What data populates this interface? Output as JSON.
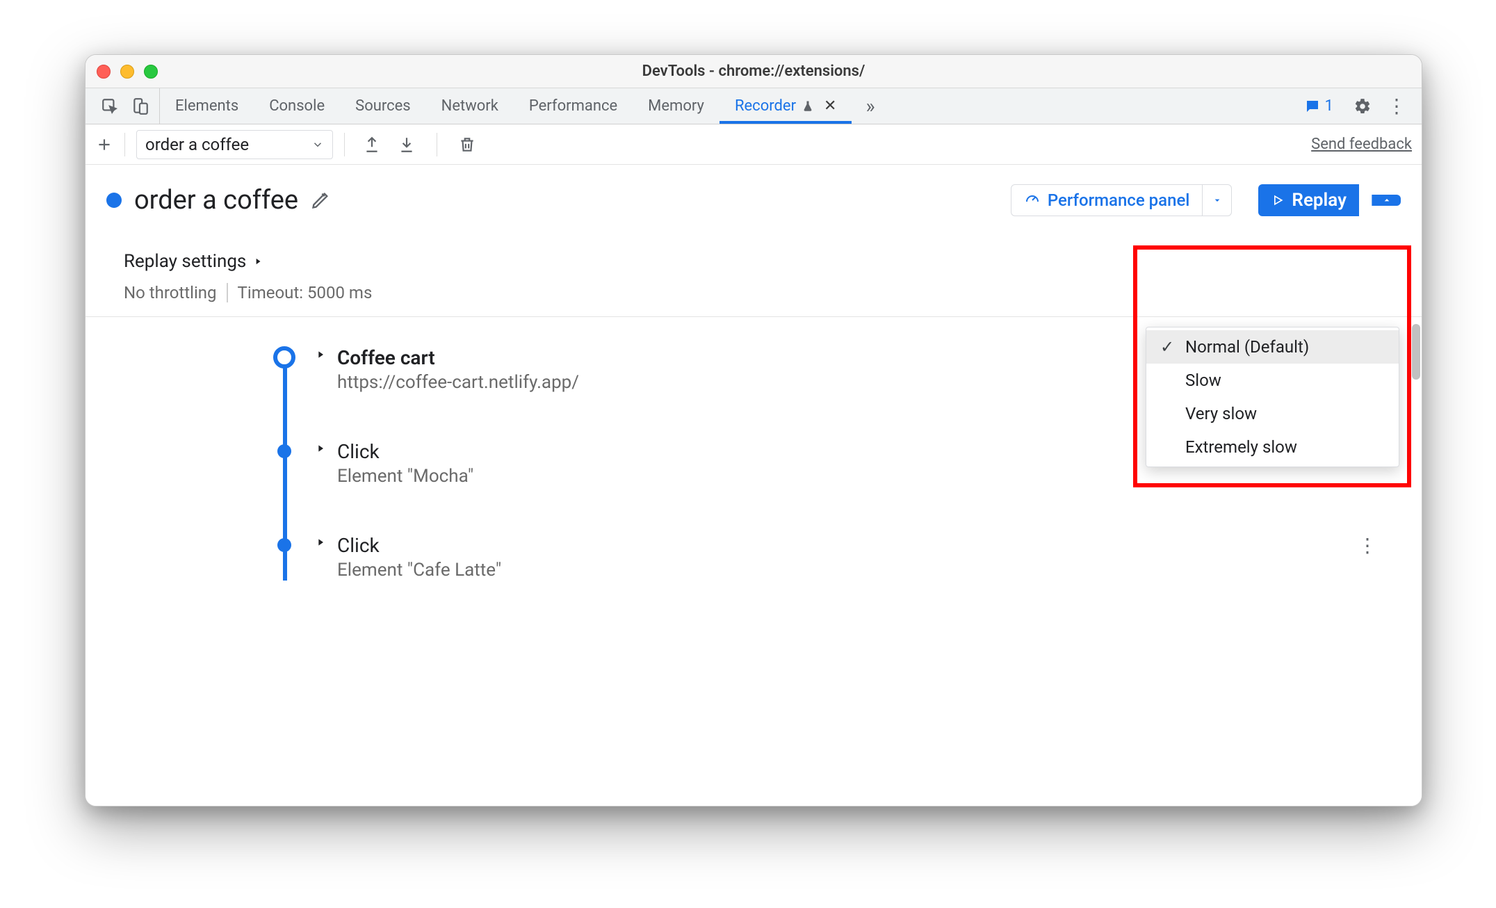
{
  "window": {
    "title": "DevTools - chrome://extensions/"
  },
  "tabs": {
    "items": [
      "Elements",
      "Console",
      "Sources",
      "Network",
      "Performance",
      "Memory"
    ],
    "active": {
      "label": "Recorder"
    },
    "issues_count": "1"
  },
  "subbar": {
    "recording_name": "order a coffee",
    "feedback": "Send feedback"
  },
  "recording": {
    "title": "order a coffee",
    "perf_panel_label": "Performance panel",
    "replay_label": "Replay"
  },
  "replay_menu": {
    "items": [
      "Normal (Default)",
      "Slow",
      "Very slow",
      "Extremely slow"
    ],
    "selected_index": 0
  },
  "replay_settings": {
    "title": "Replay settings",
    "throttling": "No throttling",
    "timeout": "Timeout: 5000 ms"
  },
  "steps": [
    {
      "title": "Coffee cart",
      "subtitle": "https://coffee-cart.netlify.app/",
      "bold": true,
      "first": true
    },
    {
      "title": "Click",
      "subtitle": "Element \"Mocha\"",
      "bold": false,
      "first": false
    },
    {
      "title": "Click",
      "subtitle": "Element \"Cafe Latte\"",
      "bold": false,
      "first": false
    }
  ]
}
